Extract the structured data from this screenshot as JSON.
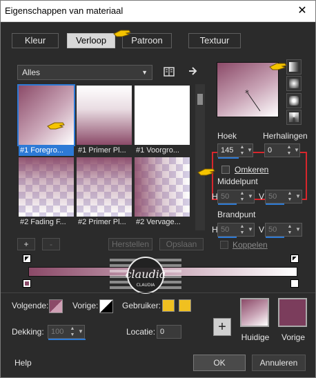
{
  "window": {
    "title": "Eigenschappen van materiaal",
    "close_glyph": "✕"
  },
  "tabs": [
    {
      "label": "Kleur",
      "active": false
    },
    {
      "label": "Verloop",
      "active": true
    },
    {
      "label": "Patroon",
      "active": false
    },
    {
      "label": "Textuur",
      "active": false
    }
  ],
  "library": {
    "category_value": "Alles",
    "items": [
      {
        "label": "#1 Foregro...",
        "selected": true
      },
      {
        "label": "#1 Primer Pl...",
        "selected": false
      },
      {
        "label": "#1 Voorgro...",
        "selected": false
      },
      {
        "label": "#2 Fading F...",
        "selected": false
      },
      {
        "label": "#2 Primer Pl...",
        "selected": false
      },
      {
        "label": "#2 Vervage...",
        "selected": false
      }
    ],
    "add_label": "+",
    "remove_label": "-",
    "restore_label": "Herstellen",
    "save_label": "Opslaan"
  },
  "properties": {
    "angle_label": "Hoek",
    "angle_value": "145",
    "repeats_label": "Herhalingen",
    "repeats_value": "0",
    "invert_label": "Omkeren",
    "invert_checked": false,
    "center_label": "Middelpunt",
    "center_h_label": "H",
    "center_h_value": "50",
    "center_v_label": "V",
    "center_v_value": "50",
    "focal_label": "Brandpunt",
    "focal_h_label": "H",
    "focal_h_value": "50",
    "focal_v_label": "V",
    "focal_v_value": "50",
    "link_label": "Koppelen",
    "link_checked": false
  },
  "materials": {
    "follow_label": "Volgende:",
    "previous_label": "Vorige:",
    "user_label": "Gebruiker:",
    "opacity_label": "Dekking:",
    "opacity_value": "100",
    "location_label": "Locatie:",
    "location_value": "0",
    "current_label": "Huidige",
    "previous_swatch_label": "Vorige",
    "add_glyph": "+"
  },
  "footer": {
    "help_label": "Help",
    "ok_label": "OK",
    "cancel_label": "Annuleren"
  },
  "watermark": {
    "brand": "claudia",
    "tag": "CLAUDIA"
  },
  "colors": {
    "gradient_dark": "#8b4a68",
    "gradient_light": "#ffffff",
    "selection_blue": "#2d7ad6",
    "highlight_red": "#d8262c",
    "user_yellow": "#f0c020"
  }
}
